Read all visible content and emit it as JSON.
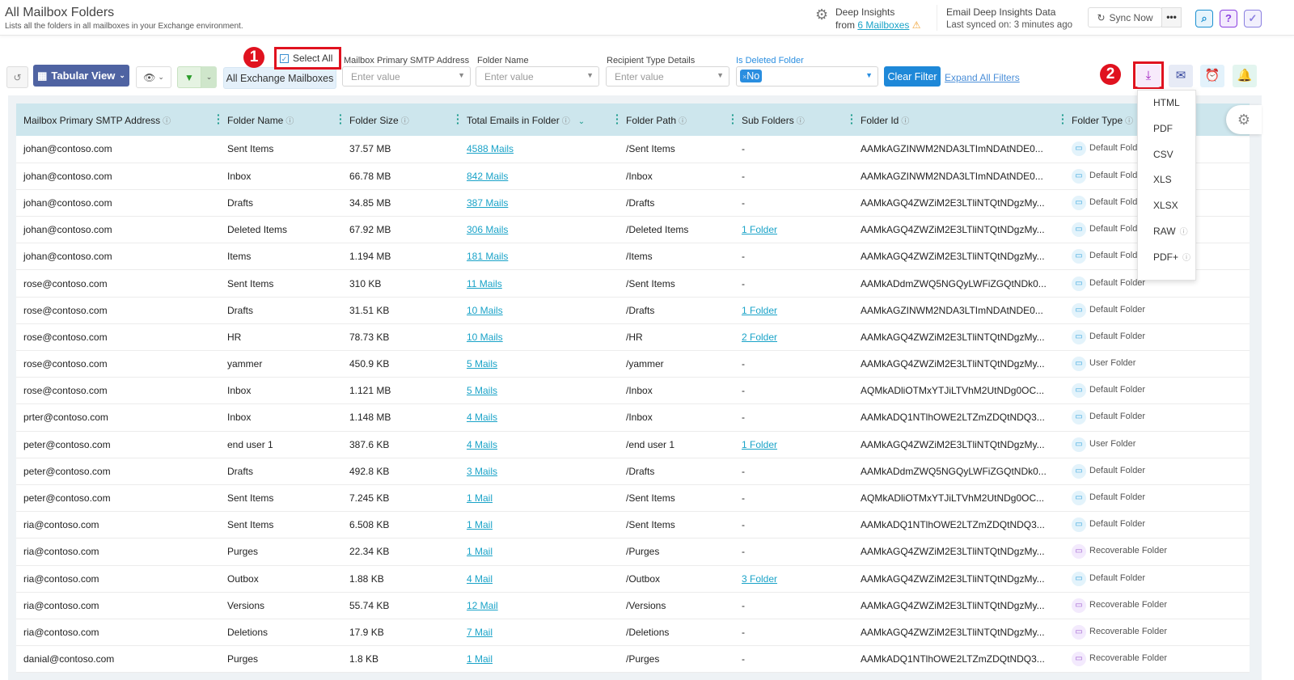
{
  "header": {
    "title": "All Mailbox Folders",
    "subtitle": "Lists all the folders in all mailboxes in your Exchange environment.",
    "deep_insights": "Deep Insights",
    "from": "from",
    "mailboxes_link": "6 Mailboxes",
    "email_data_title": "Email Deep Insights Data",
    "last_synced": "Last synced on: 3 minutes ago",
    "sync_now": "Sync Now",
    "more": "•••"
  },
  "toolbar": {
    "view": "Tabular View",
    "scope": "All Exchange Mailboxes",
    "select_all": "Select All",
    "clear_filter": "Clear Filter",
    "expand_filters": "Expand All Filters",
    "badge1": "1",
    "badge2": "2"
  },
  "filters": [
    {
      "label": "Mailbox Primary SMTP Address",
      "placeholder": "Enter value"
    },
    {
      "label": "Folder Name",
      "placeholder": "Enter value"
    },
    {
      "label": "Recipient Type Details",
      "placeholder": "Enter value"
    },
    {
      "label": "Is Deleted Folder",
      "value": "No"
    }
  ],
  "export_menu": [
    "HTML",
    "PDF",
    "CSV",
    "XLS",
    "XLSX",
    "RAW",
    "PDF+"
  ],
  "colors": {
    "accent": "#1aa3c8",
    "view_button": "#4f63a2",
    "header_row": "#cde6ed",
    "highlight": "#e0121f"
  },
  "table": {
    "columns": [
      "Mailbox Primary SMTP Address",
      "Folder Name",
      "Folder Size",
      "Total Emails in Folder",
      "Folder Path",
      "Sub Folders",
      "Folder Id",
      "Folder Type"
    ],
    "rows": [
      [
        "johan@contoso.com",
        "Sent Items",
        "37.57 MB",
        "4588 Mails",
        "/Sent Items",
        "-",
        "AAMkAGZINWM2NDA3LTImNDAtNDE0...",
        "Default Folder"
      ],
      [
        "johan@contoso.com",
        "Inbox",
        "66.78 MB",
        "842 Mails",
        "/Inbox",
        "-",
        "AAMkAGZINWM2NDA3LTImNDAtNDE0...",
        "Default Folder"
      ],
      [
        "johan@contoso.com",
        "Drafts",
        "34.85 MB",
        "387 Mails",
        "/Drafts",
        "-",
        "AAMkAGQ4ZWZiM2E3LTliNTQtNDgzMy...",
        "Default Folder"
      ],
      [
        "johan@contoso.com",
        "Deleted Items",
        "67.92 MB",
        "306 Mails",
        "/Deleted Items",
        "1 Folder",
        "AAMkAGQ4ZWZiM2E3LTliNTQtNDgzMy...",
        "Default Folder"
      ],
      [
        "johan@contoso.com",
        "Items",
        "1.194 MB",
        "181 Mails",
        "/Items",
        "-",
        "AAMkAGQ4ZWZiM2E3LTliNTQtNDgzMy...",
        "Default Folder"
      ],
      [
        "rose@contoso.com",
        "Sent Items",
        "310 KB",
        "11 Mails",
        "/Sent Items",
        "-",
        "AAMkADdmZWQ5NGQyLWFiZGQtNDk0...",
        "Default Folder"
      ],
      [
        "rose@contoso.com",
        "Drafts",
        "31.51 KB",
        "10 Mails",
        "/Drafts",
        "1 Folder",
        "AAMkAGZINWM2NDA3LTImNDAtNDE0...",
        "Default Folder"
      ],
      [
        "rose@contoso.com",
        "HR",
        "78.73 KB",
        "10 Mails",
        "/HR",
        "2 Folder",
        "AAMkAGQ4ZWZiM2E3LTliNTQtNDgzMy...",
        "Default Folder"
      ],
      [
        "rose@contoso.com",
        "yammer",
        "450.9 KB",
        "5 Mails",
        "/yammer",
        "-",
        "AAMkAGQ4ZWZiM2E3LTliNTQtNDgzMy...",
        "User Folder"
      ],
      [
        "rose@contoso.com",
        "Inbox",
        "1.121 MB",
        "5 Mails",
        "/Inbox",
        "-",
        "AQMkADliOTMxYTJiLTVhM2UtNDg0OC...",
        "Default Folder"
      ],
      [
        "prter@contoso.com",
        "Inbox",
        "1.148 MB",
        "4 Mails",
        "/Inbox",
        "-",
        "AAMkADQ1NTlhOWE2LTZmZDQtNDQ3...",
        "Default Folder"
      ],
      [
        "peter@contoso.com",
        "end user 1",
        "387.6 KB",
        "4 Mails",
        "/end user 1",
        "1 Folder",
        "AAMkAGQ4ZWZiM2E3LTliNTQtNDgzMy...",
        "User Folder"
      ],
      [
        "peter@contoso.com",
        "Drafts",
        "492.8 KB",
        "3 Mails",
        "/Drafts",
        "-",
        "AAMkADdmZWQ5NGQyLWFiZGQtNDk0...",
        "Default Folder"
      ],
      [
        "peter@contoso.com",
        "Sent Items",
        "7.245 KB",
        "1 Mail",
        "/Sent Items",
        "-",
        "AQMkADliOTMxYTJiLTVhM2UtNDg0OC...",
        "Default Folder"
      ],
      [
        "ria@contoso.com",
        "Sent Items",
        "6.508 KB",
        "1 Mail",
        "/Sent Items",
        "-",
        "AAMkADQ1NTlhOWE2LTZmZDQtNDQ3...",
        "Default Folder"
      ],
      [
        "ria@contoso.com",
        "Purges",
        "22.34 KB",
        "1 Mail",
        "/Purges",
        "-",
        "AAMkAGQ4ZWZiM2E3LTliNTQtNDgzMy...",
        "Recoverable Folder"
      ],
      [
        "ria@contoso.com",
        "Outbox",
        "1.88 KB",
        "4 Mail",
        "/Outbox",
        "3 Folder",
        "AAMkAGQ4ZWZiM2E3LTliNTQtNDgzMy...",
        "Default Folder"
      ],
      [
        "ria@contoso.com",
        "Versions",
        "55.74 KB",
        "12 Mail",
        "/Versions",
        "-",
        "AAMkAGQ4ZWZiM2E3LTliNTQtNDgzMy...",
        "Recoverable Folder"
      ],
      [
        "ria@contoso.com",
        "Deletions",
        "17.9 KB",
        "7 Mail",
        "/Deletions",
        "-",
        "AAMkAGQ4ZWZiM2E3LTliNTQtNDgzMy...",
        "Recoverable Folder"
      ],
      [
        "danial@contoso.com",
        "Purges",
        "1.8 KB",
        "1 Mail",
        "/Purges",
        "-",
        "AAMkADQ1NTlhOWE2LTZmZDQtNDQ3...",
        "Recoverable Folder"
      ]
    ]
  }
}
